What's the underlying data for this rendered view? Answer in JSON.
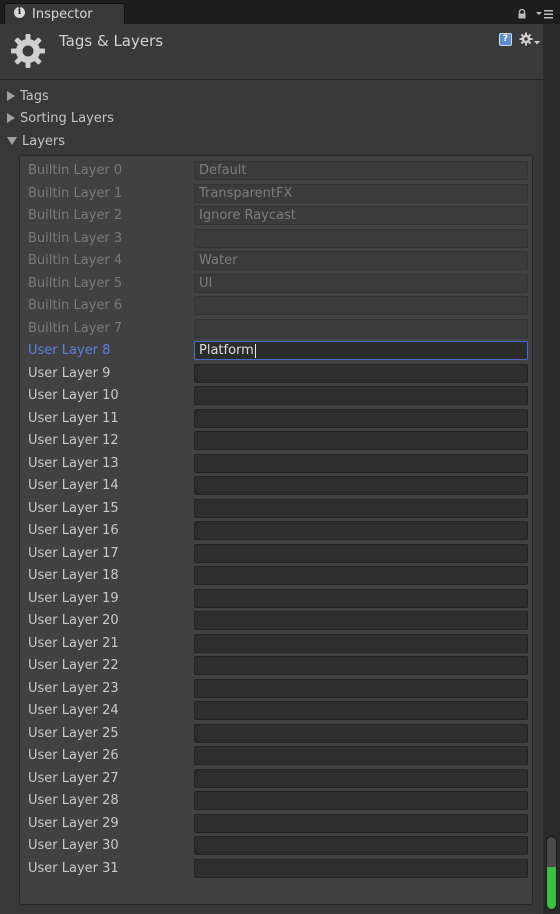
{
  "tab": {
    "label": "Inspector",
    "icon": "info-icon"
  },
  "header": {
    "title": "Tags & Layers",
    "icon": "gear-icon"
  },
  "foldouts": [
    {
      "label": "Tags",
      "expanded": false
    },
    {
      "label": "Sorting Layers",
      "expanded": false
    },
    {
      "label": "Layers",
      "expanded": true
    }
  ],
  "layers": [
    {
      "label": "Builtin Layer 0",
      "value": "Default",
      "builtin": true
    },
    {
      "label": "Builtin Layer 1",
      "value": "TransparentFX",
      "builtin": true
    },
    {
      "label": "Builtin Layer 2",
      "value": "Ignore Raycast",
      "builtin": true
    },
    {
      "label": "Builtin Layer 3",
      "value": "",
      "builtin": true
    },
    {
      "label": "Builtin Layer 4",
      "value": "Water",
      "builtin": true
    },
    {
      "label": "Builtin Layer 5",
      "value": "UI",
      "builtin": true
    },
    {
      "label": "Builtin Layer 6",
      "value": "",
      "builtin": true
    },
    {
      "label": "Builtin Layer 7",
      "value": "",
      "builtin": true
    },
    {
      "label": "User Layer 8",
      "value": "Platform",
      "builtin": false,
      "active": true
    },
    {
      "label": "User Layer 9",
      "value": "",
      "builtin": false
    },
    {
      "label": "User Layer 10",
      "value": "",
      "builtin": false
    },
    {
      "label": "User Layer 11",
      "value": "",
      "builtin": false
    },
    {
      "label": "User Layer 12",
      "value": "",
      "builtin": false
    },
    {
      "label": "User Layer 13",
      "value": "",
      "builtin": false
    },
    {
      "label": "User Layer 14",
      "value": "",
      "builtin": false
    },
    {
      "label": "User Layer 15",
      "value": "",
      "builtin": false
    },
    {
      "label": "User Layer 16",
      "value": "",
      "builtin": false
    },
    {
      "label": "User Layer 17",
      "value": "",
      "builtin": false
    },
    {
      "label": "User Layer 18",
      "value": "",
      "builtin": false
    },
    {
      "label": "User Layer 19",
      "value": "",
      "builtin": false
    },
    {
      "label": "User Layer 20",
      "value": "",
      "builtin": false
    },
    {
      "label": "User Layer 21",
      "value": "",
      "builtin": false
    },
    {
      "label": "User Layer 22",
      "value": "",
      "builtin": false
    },
    {
      "label": "User Layer 23",
      "value": "",
      "builtin": false
    },
    {
      "label": "User Layer 24",
      "value": "",
      "builtin": false
    },
    {
      "label": "User Layer 25",
      "value": "",
      "builtin": false
    },
    {
      "label": "User Layer 26",
      "value": "",
      "builtin": false
    },
    {
      "label": "User Layer 27",
      "value": "",
      "builtin": false
    },
    {
      "label": "User Layer 28",
      "value": "",
      "builtin": false
    },
    {
      "label": "User Layer 29",
      "value": "",
      "builtin": false
    },
    {
      "label": "User Layer 30",
      "value": "",
      "builtin": false
    },
    {
      "label": "User Layer 31",
      "value": "",
      "builtin": false
    }
  ],
  "colors": {
    "active_label": "#5c7fe4",
    "active_border": "#4a68d4",
    "scroll_fill": "#3bbf44"
  }
}
